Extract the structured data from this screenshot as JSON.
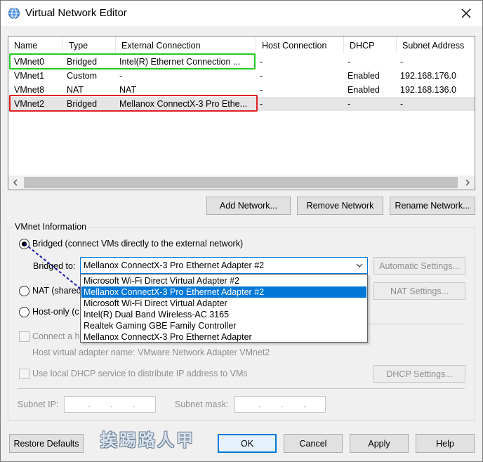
{
  "window": {
    "title": "Virtual Network Editor"
  },
  "table": {
    "columns": [
      "Name",
      "Type",
      "External Connection",
      "Host Connection",
      "DHCP",
      "Subnet Address"
    ],
    "rows": [
      {
        "name": "VMnet0",
        "type": "Bridged",
        "external": "Intel(R) Ethernet Connection ...",
        "host": "-",
        "dhcp": "-",
        "subnet": "-"
      },
      {
        "name": "VMnet1",
        "type": "Custom",
        "external": "-",
        "host": "-",
        "dhcp": "Enabled",
        "subnet": "192.168.176.0"
      },
      {
        "name": "VMnet8",
        "type": "NAT",
        "external": "NAT",
        "host": "-",
        "dhcp": "Enabled",
        "subnet": "192.168.136.0"
      },
      {
        "name": "VMnet2",
        "type": "Bridged",
        "external": "Mellanox ConnectX-3 Pro Ethe...",
        "host": "-",
        "dhcp": "-",
        "subnet": "-"
      }
    ]
  },
  "buttons": {
    "add": "Add Network...",
    "remove": "Remove Network",
    "rename": "Rename Network...",
    "auto": "Automatic Settings...",
    "nat": "NAT Settings...",
    "dhcp": "DHCP Settings...",
    "restore": "Restore Defaults",
    "ok": "OK",
    "cancel": "Cancel",
    "apply": "Apply",
    "help": "Help"
  },
  "info": {
    "group_label": "VMnet Information",
    "bridged": "Bridged (connect VMs directly to the external network)",
    "bridged_to": "Bridged to:",
    "selected_adapter": "Mellanox ConnectX-3 Pro Ethernet Adapter #2",
    "nat": "NAT (shared",
    "hostonly": "Host-only (c",
    "connect_host": "Connect a h",
    "host_adapter": "Host virtual adapter name: VMware Network Adapter VMnet2",
    "dhcp_check": "Use local DHCP service to distribute IP address to VMs",
    "subnet_ip": "Subnet IP:",
    "subnet_mask": "Subnet mask:"
  },
  "dropdown": {
    "options": [
      "Microsoft Wi-Fi Direct Virtual Adapter #2",
      "Mellanox ConnectX-3 Pro Ethernet Adapter #2",
      "Microsoft Wi-Fi Direct Virtual Adapter",
      "Intel(R) Dual Band Wireless-AC 3165",
      "Realtek Gaming GBE Family Controller",
      "Mellanox ConnectX-3 Pro Ethernet Adapter"
    ],
    "selected_index": 1
  },
  "watermark": "挨踢路人甲",
  "colors": {
    "accent": "#0078d7",
    "highlight_green": "#22cc22",
    "highlight_red": "#e02020",
    "selected_row": "#e5e5e5"
  }
}
